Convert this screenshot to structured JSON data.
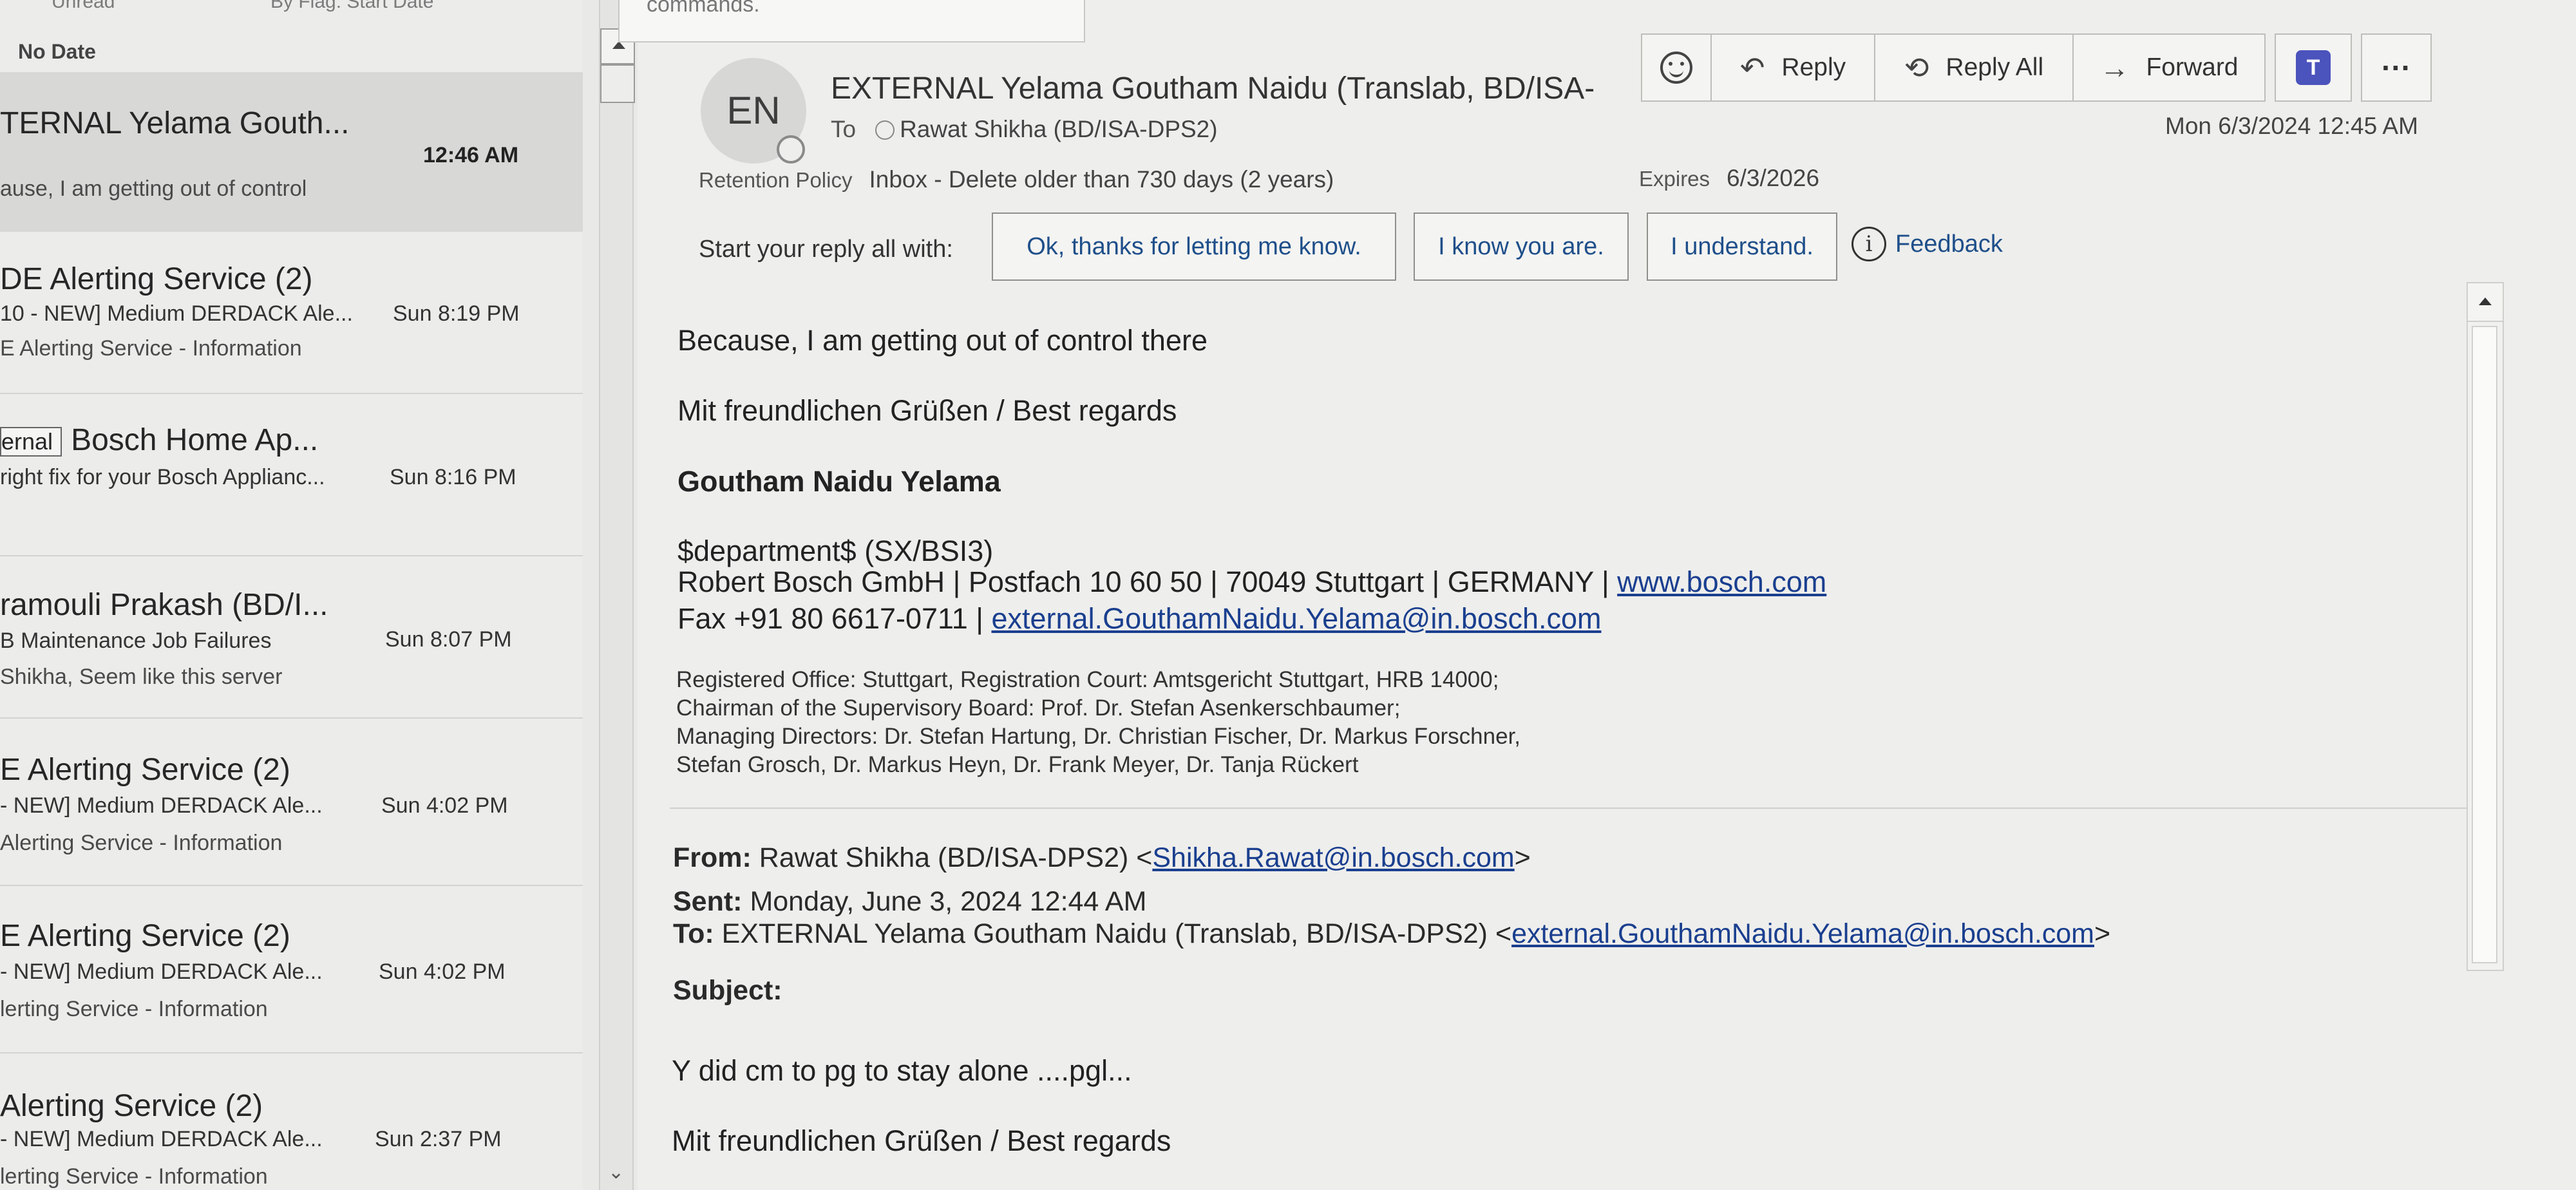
{
  "tooltip": {
    "text": "commands."
  },
  "list": {
    "top_strip": [
      "Unread",
      "By Flag: Start Date"
    ],
    "group_header": "No Date",
    "messages": [
      {
        "sender": "TERNAL Yelama Gouth...",
        "subject": "",
        "time": "12:46 AM",
        "preview": "ause, I am getting out of control",
        "selected": true
      },
      {
        "sender": "DE Alerting Service (2)",
        "subject": "10 - NEW] Medium DERDACK Ale...",
        "time": "Sun 8:19 PM",
        "preview": "E Alerting Service - Information"
      },
      {
        "tag": "ernal",
        "sender": "Bosch Home Ap...",
        "subject": "right fix for your Bosch Applianc...",
        "time": "Sun 8:16 PM",
        "preview": ""
      },
      {
        "sender": "ramouli Prakash (BD/I...",
        "subject": "B Maintenance Job Failures",
        "time": "Sun 8:07 PM",
        "preview": "Shikha,  Seem like this server"
      },
      {
        "sender": "E Alerting Service (2)",
        "subject": "- NEW] Medium DERDACK Ale...",
        "time": "Sun 4:02 PM",
        "preview": "Alerting Service - Information"
      },
      {
        "sender": "E Alerting Service (2)",
        "subject": "- NEW] Medium DERDACK Ale...",
        "time": "Sun 4:02 PM",
        "preview": "lerting Service - Information"
      },
      {
        "sender": "Alerting Service (2)",
        "subject": "- NEW] Medium DERDACK Ale...",
        "time": "Sun 2:37 PM",
        "preview": "lerting Service - Information"
      }
    ]
  },
  "email": {
    "avatar_initials": "EN",
    "from": "EXTERNAL Yelama Goutham Naidu (Translab, BD/ISA-",
    "to_label": "To",
    "to": "Rawat Shikha (BD/ISA-DPS2)",
    "date": "Mon 6/3/2024 12:45 AM",
    "retention_label": "Retention Policy",
    "retention_value": "Inbox - Delete older than 730 days (2 years)",
    "expires_label": "Expires",
    "expires_value": "6/3/2026"
  },
  "toolbar": {
    "reply": "Reply",
    "reply_all": "Reply All",
    "forward": "Forward",
    "more": "···",
    "teams": "T"
  },
  "suggestions": {
    "label": "Start your reply all with:",
    "items": [
      "Ok, thanks for letting me know.",
      "I know you are.",
      "I understand."
    ],
    "feedback": "Feedback"
  },
  "body": {
    "line1": "Because, I am getting out of control there",
    "regards1": "Mit freundlichen Grüßen / Best regards",
    "signature_name": "Goutham Naidu Yelama",
    "department": "$department$ (SX/BSI3)",
    "company_line": "Robert Bosch GmbH | Postfach 10 60 50 | 70049 Stuttgart | GERMANY | ",
    "company_link": "www.bosch.com",
    "fax_line": "Fax +91 80 6617-0711 | ",
    "fax_link": "external.GouthamNaidu.Yelama@in.bosch.com",
    "legal": [
      "Registered Office: Stuttgart, Registration Court: Amtsgericht Stuttgart, HRB 14000;",
      "Chairman of the Supervisory Board: Prof. Dr. Stefan Asenkerschbaumer;",
      "Managing Directors: Dr. Stefan Hartung, Dr. Christian Fischer, Dr. Markus Forschner,",
      "Stefan Grosch, Dr. Markus Heyn, Dr. Frank Meyer, Dr. Tanja Rückert"
    ],
    "quoted": {
      "from_label": "From:",
      "from_text": "Rawat Shikha (BD/ISA-DPS2) <",
      "from_link": "Shikha.Rawat@in.bosch.com",
      "from_close": ">",
      "sent_label": "Sent:",
      "sent_text": "Monday, June 3, 2024 12:44 AM",
      "to_label": "To:",
      "to_text": "EXTERNAL Yelama Goutham Naidu (Translab, BD/ISA-DPS2) <",
      "to_link": "external.GouthamNaidu.Yelama@in.bosch.com",
      "to_close": ">",
      "subject_label": "Subject:",
      "message": "Y did cm to pg to stay alone ....pgl...",
      "regards": "Mit freundlichen Grüßen / Best regards"
    }
  }
}
